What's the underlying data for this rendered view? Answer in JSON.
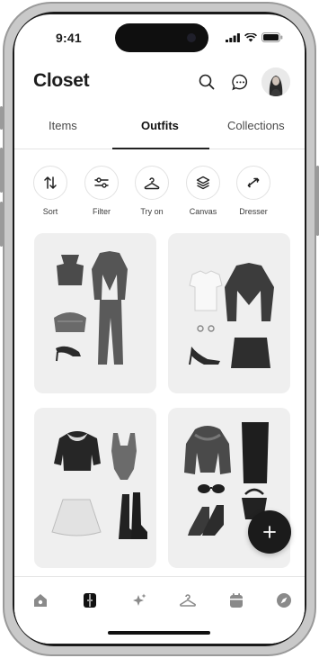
{
  "status_bar": {
    "time": "9:41"
  },
  "header": {
    "title": "Closet"
  },
  "tabs": [
    {
      "label": "Items",
      "active": false
    },
    {
      "label": "Outfits",
      "active": true
    },
    {
      "label": "Collections",
      "active": false
    }
  ],
  "actions": [
    {
      "label": "Sort",
      "icon": "sort-arrows-icon"
    },
    {
      "label": "Filter",
      "icon": "filter-sliders-icon"
    },
    {
      "label": "Try on",
      "icon": "hanger-icon"
    },
    {
      "label": "Canvas",
      "icon": "layers-icon"
    },
    {
      "label": "Dresser",
      "icon": "shuffle-arrows-icon"
    }
  ],
  "outfits": [
    {
      "name": "outfit-card-1",
      "items": [
        "crop-top",
        "blazer",
        "trousers",
        "clutch-bag",
        "heels"
      ]
    },
    {
      "name": "outfit-card-2",
      "items": [
        "t-shirt",
        "blazer",
        "skirt",
        "earrings",
        "heels"
      ]
    },
    {
      "name": "outfit-card-3",
      "items": [
        "jacket",
        "bodysuit",
        "skirt",
        "boots"
      ]
    },
    {
      "name": "outfit-card-4",
      "items": [
        "fur-coat",
        "pencil-skirt",
        "sunglasses",
        "handbag",
        "boots"
      ]
    }
  ],
  "bottom_nav": [
    {
      "icon": "home-icon",
      "active": false
    },
    {
      "icon": "wardrobe-icon",
      "active": true
    },
    {
      "icon": "sparkle-icon",
      "active": false
    },
    {
      "icon": "hanger-icon",
      "active": false
    },
    {
      "icon": "calendar-icon",
      "active": false
    },
    {
      "icon": "compass-icon",
      "active": false
    }
  ],
  "colors": {
    "accent": "#1b1b1b",
    "card_bg": "#efefef",
    "text": "#1c1c1c"
  }
}
